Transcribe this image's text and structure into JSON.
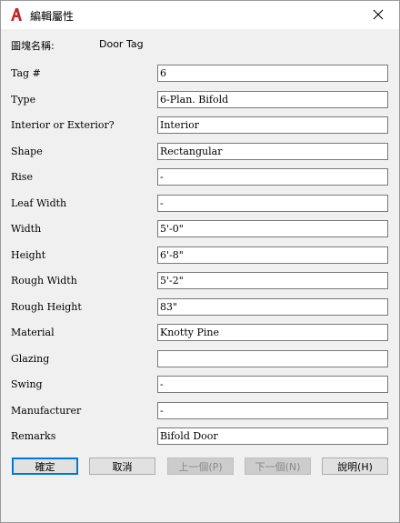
{
  "dialog": {
    "title": "編輯屬性",
    "block_name_label": "圖塊名稱:",
    "block_name_value": "Door Tag"
  },
  "attributes": [
    {
      "label": "Tag #",
      "value": "6"
    },
    {
      "label": "Type",
      "value": "6-Plan. Bifold"
    },
    {
      "label": "Interior or Exterior?",
      "value": "Interior"
    },
    {
      "label": "Shape",
      "value": "Rectangular"
    },
    {
      "label": "Rise",
      "value": "-"
    },
    {
      "label": "Leaf Width",
      "value": "-"
    },
    {
      "label": "Width",
      "value": "5'-0\""
    },
    {
      "label": "Height",
      "value": "6'-8\""
    },
    {
      "label": "Rough Width",
      "value": "5'-2\""
    },
    {
      "label": "Rough Height",
      "value": "83\""
    },
    {
      "label": "Material",
      "value": "Knotty Pine"
    },
    {
      "label": "Glazing",
      "value": ""
    },
    {
      "label": "Swing",
      "value": "-"
    },
    {
      "label": "Manufacturer",
      "value": "-"
    },
    {
      "label": "Remarks",
      "value": "Bifold Door"
    }
  ],
  "buttons": {
    "ok": "確定",
    "cancel": "取消",
    "prev": "上一個(P)",
    "next": "下一個(N)",
    "help": "說明(H)"
  },
  "icons": {
    "app": "autocad-icon",
    "close": "close-icon"
  },
  "colors": {
    "accent": "#0078d7",
    "app_icon": "#c4262e"
  }
}
